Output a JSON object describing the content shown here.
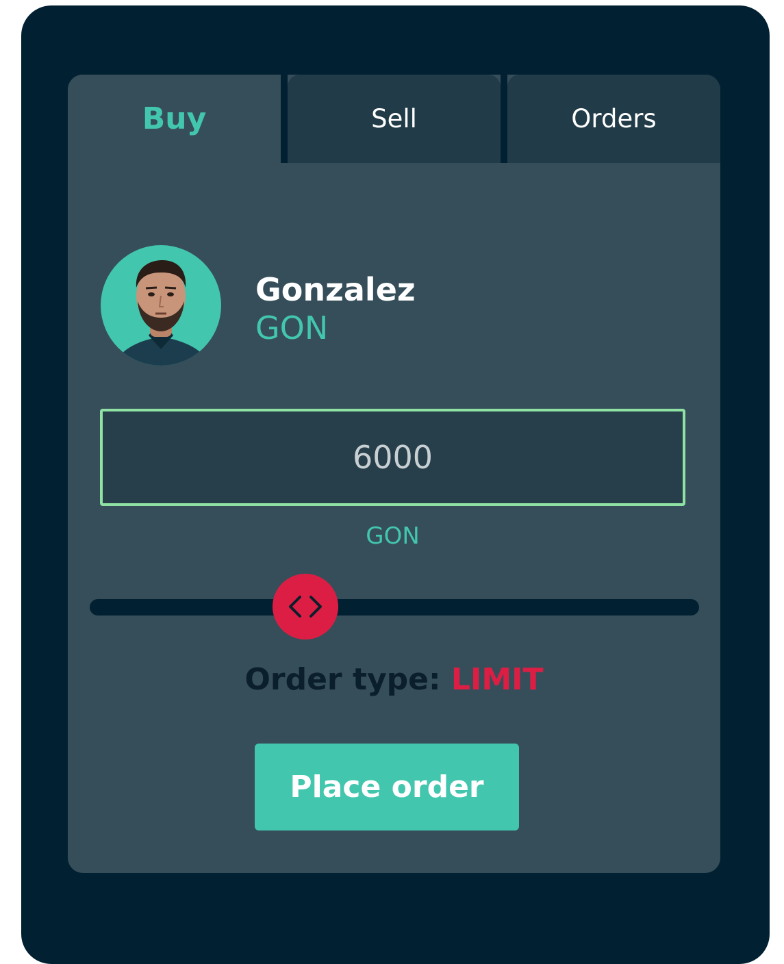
{
  "tabs": {
    "buy": "Buy",
    "sell": "Sell",
    "orders": "Orders"
  },
  "player": {
    "name": "Gonzalez",
    "code": "GON",
    "avatar_icon": "player-photo"
  },
  "order": {
    "amount": "6000",
    "unit": "GON",
    "slider_value_fraction": 0.35,
    "type_label": "Order type:",
    "type_value": "LIMIT",
    "submit_label": "Place order"
  },
  "colors": {
    "background": "#012031",
    "card": "#364e5a",
    "accent": "#43c6ae",
    "danger": "#dd1e44",
    "input_border": "#8fe2a4"
  }
}
